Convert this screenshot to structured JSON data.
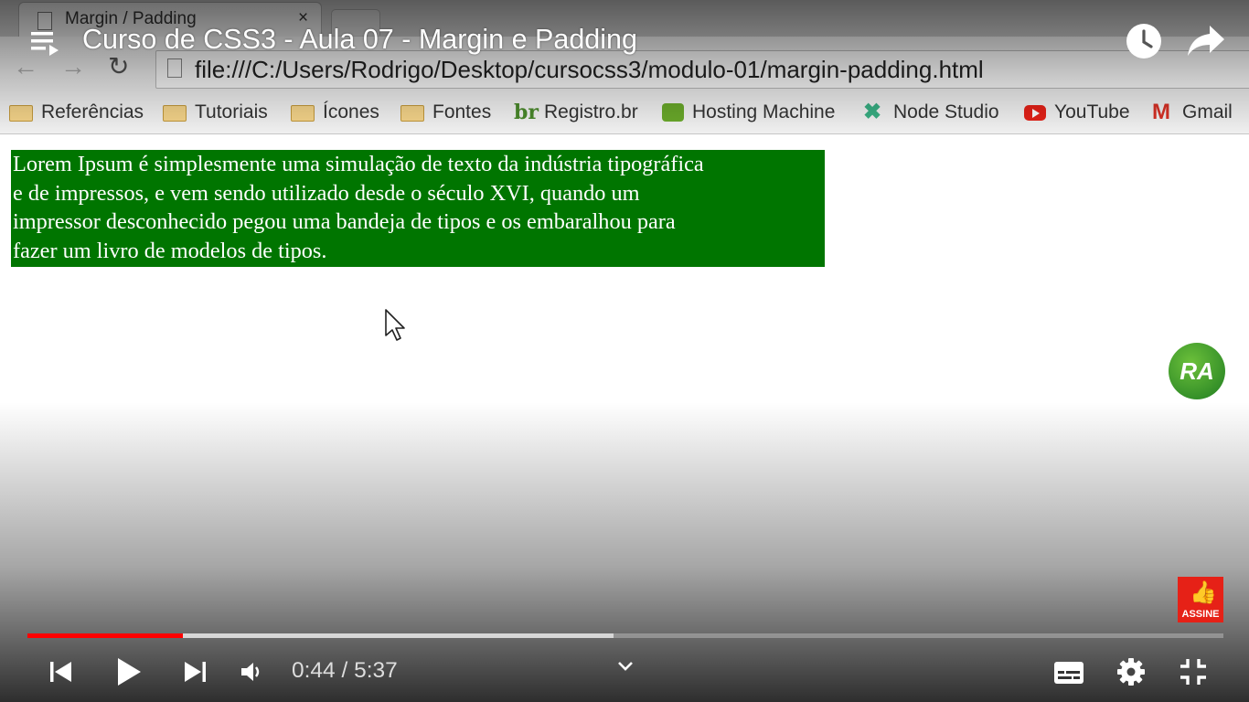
{
  "player": {
    "title": "Curso de CSS3 - Aula 07 - Margin e Padding",
    "current_time": "0:44",
    "time_separator": " / ",
    "duration": "5:37",
    "progress_played_fraction": 0.13,
    "progress_buffered_fraction": 0.49,
    "channel_avatar_text": "RA",
    "subscribe_label": "ASSINE",
    "colors": {
      "progress": "#ff0000",
      "subscribe": "#e62117",
      "avatar": "#3a9a2a"
    }
  },
  "browser": {
    "tab_title": "Margin / Padding",
    "tab_close": "×",
    "url": "file:///C:/Users/Rodrigo/Desktop/cursocss3/modulo-01/margin-padding.html",
    "bookmarks": [
      {
        "label": "Referências",
        "icon": "folder-icon"
      },
      {
        "label": "Tutoriais",
        "icon": "folder-icon"
      },
      {
        "label": "Ícones",
        "icon": "folder-icon"
      },
      {
        "label": "Fontes",
        "icon": "folder-icon"
      },
      {
        "label": "Registro.br",
        "icon": "registro-br-icon"
      },
      {
        "label": "Hosting Machine",
        "icon": "hosting-machine-icon"
      },
      {
        "label": "Node Studio",
        "icon": "node-studio-icon"
      },
      {
        "label": "YouTube",
        "icon": "youtube-icon"
      },
      {
        "label": "Gmail",
        "icon": "gmail-icon"
      }
    ]
  },
  "page": {
    "lorem_lines": [
      "Lorem Ipsum é simplesmente uma simulação de texto da indústria tipográfica",
      "e de impressos, e vem sendo utilizado desde o século XVI, quando um",
      "impressor desconhecido pegou uma bandeja de tipos e os embaralhou para",
      "fazer um livro de modelos de tipos."
    ],
    "box_color": "#007500"
  }
}
